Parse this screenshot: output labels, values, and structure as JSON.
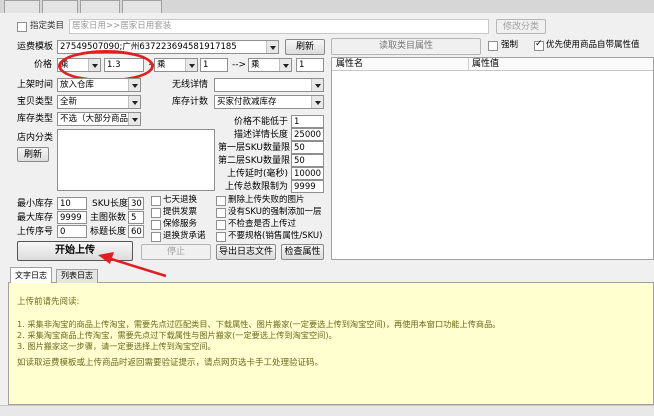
{
  "top_tabs": [
    "",
    "",
    "",
    ""
  ],
  "category": {
    "checkbox_label": "指定类目",
    "value": "居家日用>>居家日用套装",
    "modify_label": "修改分类"
  },
  "freight": {
    "label": "运费模板",
    "value": "27549507090;广州63722369458191718​5",
    "refresh_label": "刷新"
  },
  "read_attr_label": "读取类目属性",
  "force_label": "强制",
  "prefer_label": "优先使用商品自带属性值",
  "price": {
    "label": "价格",
    "op1": "乘",
    "v1": "1.3",
    "sep1": "+",
    "op2": "乘",
    "v2": "1",
    "arrow": "-->",
    "op3": "乘",
    "v3": "1"
  },
  "attr_table": {
    "col1": "属性名",
    "col2": "属性值"
  },
  "fields": {
    "list_time_label": "上架时间",
    "list_time_value": "放入仓库",
    "no_detail_label": "无线详情",
    "no_detail_value": "",
    "type_label": "宝贝类型",
    "type_value": "全新",
    "stock_count_label": "库存计数",
    "stock_count_value": "买家付款减库存",
    "stock_type_label": "库存类型",
    "stock_type_value": "不选（大部分商品",
    "shop_cat_label": "店内分类",
    "refresh_label": "刷新"
  },
  "limits": {
    "min_price_label": "价格不能低于",
    "min_price": "1",
    "detail_len_label": "描述详情长度",
    "detail_len": "25000",
    "l1_label": "第一层SKU数量限",
    "l1": "50",
    "l2_label": "第二层SKU数量限",
    "l2": "50",
    "delay_label": "上传延时(毫秒)",
    "delay": "10000",
    "total_label": "上传总数限制为",
    "total": "9999"
  },
  "stock": {
    "min_label": "最小库存",
    "min": "10",
    "max_label": "最大库存",
    "max": "9999",
    "seq_label": "上传序号",
    "seq": "0",
    "sku_len_label": "SKU长度",
    "sku_len": "30",
    "main_img_label": "主图张数",
    "main_img": "5",
    "title_len_label": "标题长度",
    "title_len": "60"
  },
  "checks": {
    "seven_day": "七天退换",
    "invoice": "提供发票",
    "warranty": "保修服务",
    "return_commit": "退换货承诺",
    "del_failed": "删除上传失败的图片",
    "add_sku": "没有SKU的强制添加一层",
    "no_check": "不检查是否上传过",
    "no_spec": "不要规格(销售属性/SKU)"
  },
  "buttons": {
    "start": "开始上传",
    "stop": "停止",
    "export_log": "导出日志文件",
    "check_attr": "检查属性"
  },
  "log_tabs": {
    "text_log": "文字日志",
    "list_log": "列表日志"
  },
  "log": {
    "heading": "上传前请先阅读:",
    "line1": "1. 采集非淘宝的商品上传淘宝，需要先点过匹配类目、下载属性、图片搬家(一定要选上传到淘宝空间)，再使用本窗口功能上传商品。",
    "line2": "2. 采集淘宝商品上传淘宝，需要先点过下载属性与图片搬家(一定要选上传到淘宝空间)。",
    "line3": "3. 图片搬家这一步骤，请一定要选择上传到淘宝空间。",
    "footer": "如读取运费模板或上传商品时返回需要验证提示，请点网页选卡手工处理验证码。"
  },
  "colors": {
    "annotation": "#e02020",
    "log_bg": "#ffffd0",
    "log_text": "#6b6b1e"
  }
}
